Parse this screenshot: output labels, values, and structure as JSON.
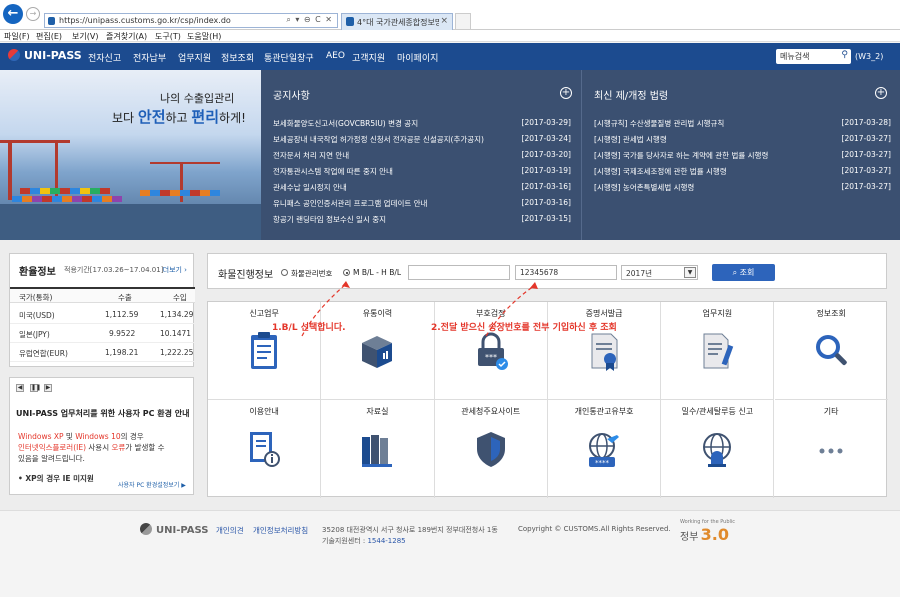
{
  "browser": {
    "back_icon": "arrow-left-icon",
    "url": "https://unipass.customs.go.kr/csp/index.do",
    "address_tools": "⌕ ▾ ⊖ C ✕",
    "tab_title": "4°대 국가관세종합정보망...",
    "tab_close": "×",
    "menu": [
      "파일(F)",
      "편집(E)",
      "보기(V)",
      "즐겨찾기(A)",
      "도구(T)",
      "도움말(H)"
    ]
  },
  "header": {
    "logo": "UNI-PASS",
    "nav": [
      "전자신고",
      "전자납부",
      "업무지원",
      "정보조회",
      "통관단일창구",
      "AEO",
      "고객지원",
      "마이페이지"
    ],
    "menu_search_placeholder": "메뉴검색",
    "user": "(W3_2)"
  },
  "hero": {
    "line1": "나의 수출입관리",
    "line2_a": "보다 ",
    "line2_b": "안전",
    "line2_c": "하고 ",
    "line2_d": "편리",
    "line2_e": "하게!"
  },
  "notice": {
    "title": "공지사항",
    "items": [
      {
        "t": "보세화물양도신고서(GOVCBR5IU) 변경 공지",
        "d": "[2017-03-29]"
      },
      {
        "t": "보세공장내 내국작업 허가정정 신청서 전자공문 신설공지(추가공지)",
        "d": "[2017-03-24]"
      },
      {
        "t": "전자문서 처리 지연 안내",
        "d": "[2017-03-20]"
      },
      {
        "t": "전자통관시스템 작업에 따른 중지 안내",
        "d": "[2017-03-19]"
      },
      {
        "t": "관세수납 일시정지 안내",
        "d": "[2017-03-16]"
      },
      {
        "t": "유니패스 공인인증서관리 프로그램 업데이트 안내",
        "d": "[2017-03-16]"
      },
      {
        "t": "항공기 랜딩타임 정보수신 일시 중지",
        "d": "[2017-03-15]"
      }
    ]
  },
  "laws": {
    "title": "최신 제/개정 법령",
    "items": [
      {
        "t": "[시행규칙] 수산생물질병 관리법 시행규칙",
        "d": "[2017-03-28]"
      },
      {
        "t": "[시행령] 관세법 시행령",
        "d": "[2017-03-27]"
      },
      {
        "t": "[시행령] 국가를 당사자로 하는 계약에 관한 법률 시행령",
        "d": "[2017-03-27]"
      },
      {
        "t": "[시행령] 국제조세조정에 관한 법률 시행령",
        "d": "[2017-03-27]"
      },
      {
        "t": "[시행령] 농어촌특별세법 시행령",
        "d": "[2017-03-27]"
      }
    ]
  },
  "rates": {
    "title": "환율정보",
    "period": "적용기간[17.03.26~17.04.01]",
    "more": "더보기 ›",
    "col_country": "국가(통화)",
    "col_export": "수출",
    "col_import": "수입",
    "rows": [
      {
        "c": "미국(USD)",
        "e": "1,112.59",
        "i": "1,134.29"
      },
      {
        "c": "일본(JPY)",
        "e": "9.9522",
        "i": "10.1471"
      },
      {
        "c": "유럽연합(EUR)",
        "e": "1,198.21",
        "i": "1,222.25"
      }
    ]
  },
  "guide": {
    "controls": [
      "◀",
      "❚❚",
      "▶"
    ],
    "title": "UNI-PASS 업무처리를 위한 사용자 PC 환경 안내",
    "l1_a": "Windows XP",
    "l1_b": " 및 ",
    "l1_c": "Windows 10",
    "l1_d": "의 경우",
    "l2_a": "인터넷익스플로러(IE)",
    "l2_b": " 사용시 ",
    "l2_c": "오류",
    "l2_d": "가 발생할 수",
    "l3": "있음을 알려드립니다.",
    "bullet": "• XP의 경우 IE 미지원",
    "more": "사용자 PC 환경설정보기 ▶"
  },
  "tracking": {
    "title": "화물진행정보",
    "opt1": "화물관리번호",
    "opt2": "M B/L - H B/L",
    "mbl_value": "",
    "hbl_value": "12345678",
    "year": "2017년",
    "search_btn": "⌕ 조회"
  },
  "grid": [
    {
      "label": "신고업무",
      "icon": "clipboard-icon"
    },
    {
      "label": "유통이력",
      "icon": "box-icon"
    },
    {
      "label": "부호검정",
      "icon": "lock-check-icon"
    },
    {
      "label": "증명서발급",
      "icon": "certificate-icon"
    },
    {
      "label": "업무지원",
      "icon": "document-pen-icon"
    },
    {
      "label": "정보조회",
      "icon": "magnifier-icon"
    },
    {
      "label": "이용안내",
      "icon": "info-document-icon"
    },
    {
      "label": "자료실",
      "icon": "books-icon"
    },
    {
      "label": "관세청주요사이트",
      "icon": "shield-icon"
    },
    {
      "label": "개인통관고유부호",
      "icon": "airplane-globe-icon"
    },
    {
      "label": "밀수/관세탈루등 신고",
      "icon": "globe-siren-icon"
    },
    {
      "label": "기타",
      "icon": "more-dots-icon"
    }
  ],
  "annotations": {
    "a1": "1.B/L 선택합니다.",
    "a2": "2.전달 받으신 송장번호를 전부 기입하신 후 조회"
  },
  "footer": {
    "logo": "UNI-PASS",
    "link1": "개인의견",
    "link2": "개인정보처리방침",
    "address": "35208 대전광역시 서구 청사로 189번지 정부대전청사 1동",
    "copyright": "Copyright © CUSTOMS.All Rights Reserved.",
    "tel_label": "기술지원센터 : ",
    "tel": "1544-1285",
    "gov_small": "Working for the Public",
    "gov": "정부",
    "gov_num": "3.0"
  }
}
